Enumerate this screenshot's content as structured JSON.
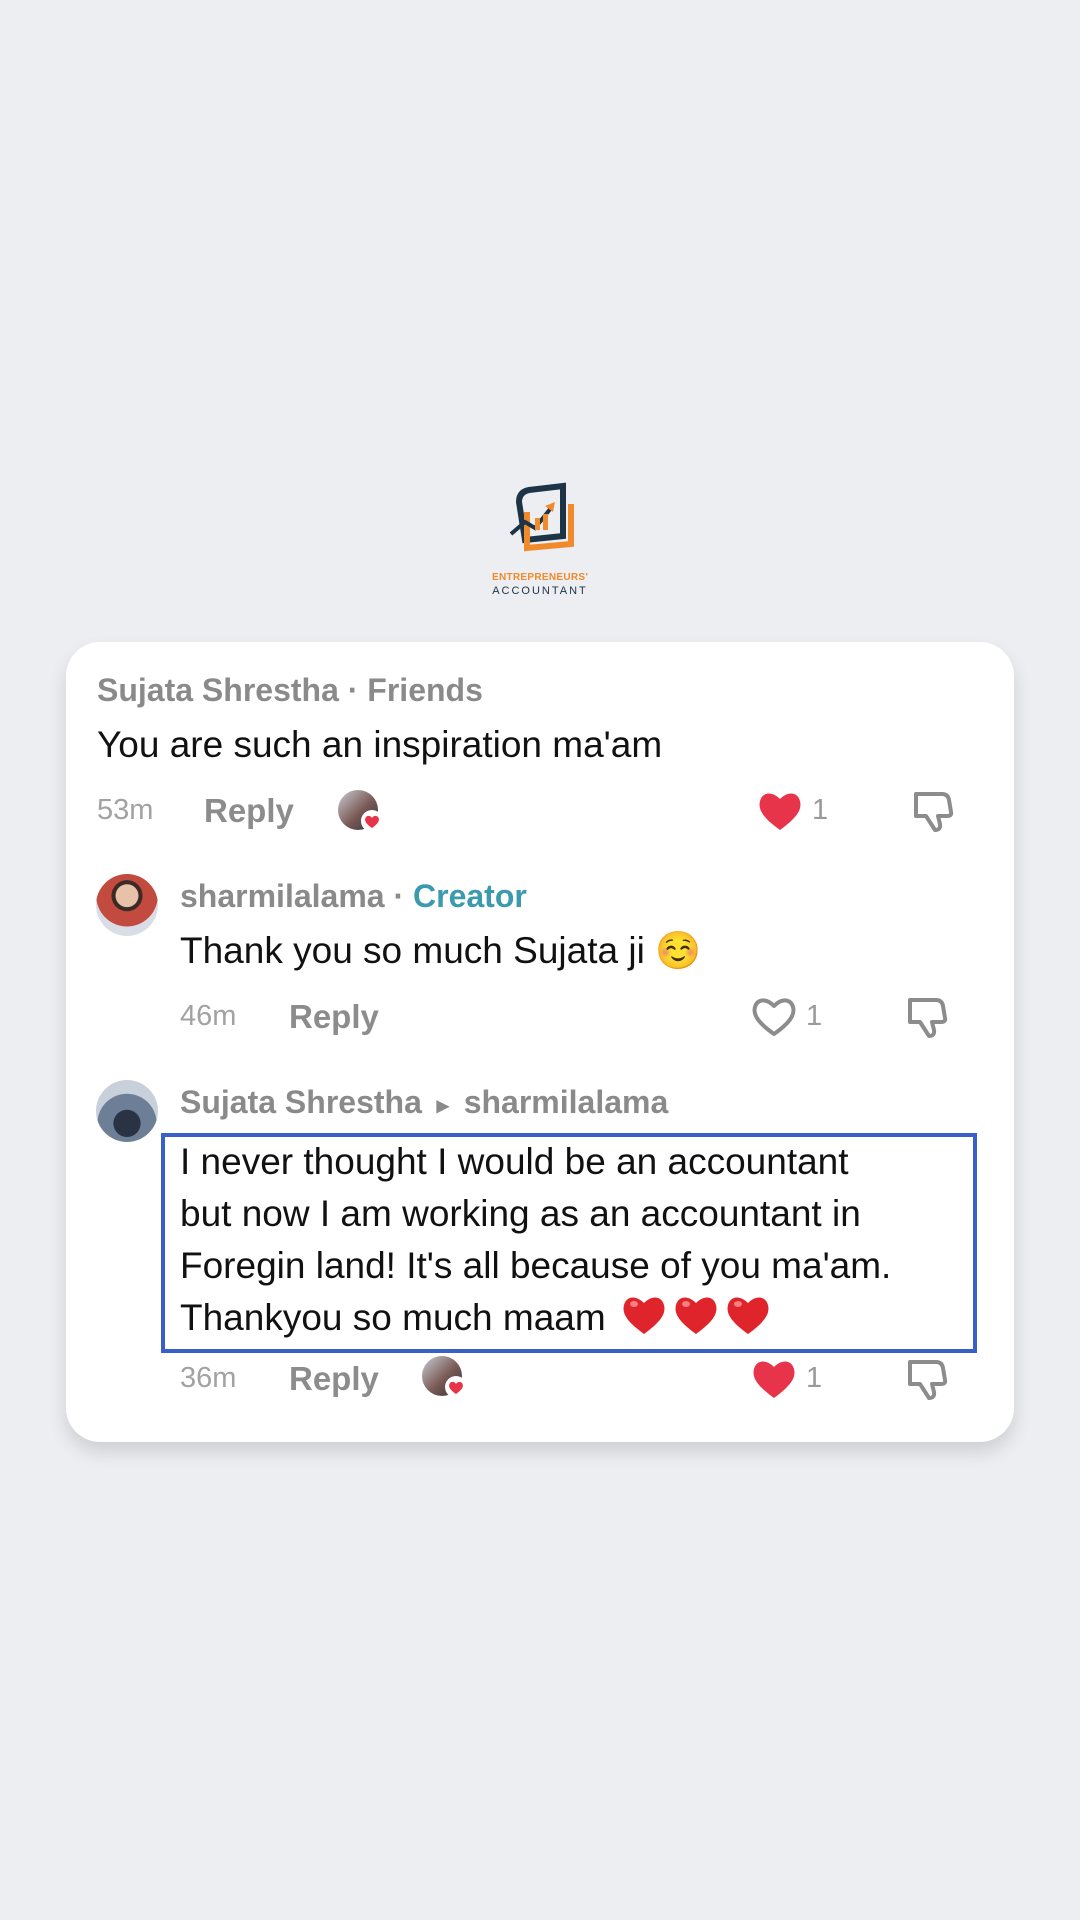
{
  "logo": {
    "line1": "ENTREPRENEURS'",
    "line2": "ACCOUNTANT",
    "colors": {
      "orange": "#f08a2a",
      "navy": "#1d3346"
    }
  },
  "colors": {
    "accent_like": "#e8344a",
    "creator_badge": "#3b9aae",
    "highlight_border": "#3a5fc8"
  },
  "comments": [
    {
      "author": "Sujata Shrestha",
      "relation": "· Friends",
      "text": "You are such an inspiration ma'am",
      "time": "53m",
      "reply_label": "Reply",
      "liked_by_creator": true,
      "like_count": "1",
      "liked": true
    },
    {
      "author": "sharmilalama",
      "separator": "·",
      "badge": "Creator",
      "text": "Thank you so much Sujata ji",
      "text_emoji": "☺️",
      "time": "46m",
      "reply_label": "Reply",
      "like_count": "1",
      "liked": false
    },
    {
      "author": "Sujata Shrestha",
      "reply_arrow": "▸",
      "reply_to": "sharmilalama",
      "text_lines": [
        "I never thought I would be an accountant",
        "but now I am working as an accountant in",
        "Foregin land! It's all because of you ma'am.",
        "Thankyou so much maam"
      ],
      "time": "36m",
      "reply_label": "Reply",
      "liked_by_creator": true,
      "like_count": "1",
      "liked": true
    }
  ],
  "icons": {
    "like": "heart-icon",
    "dislike": "thumbs-down-icon"
  }
}
